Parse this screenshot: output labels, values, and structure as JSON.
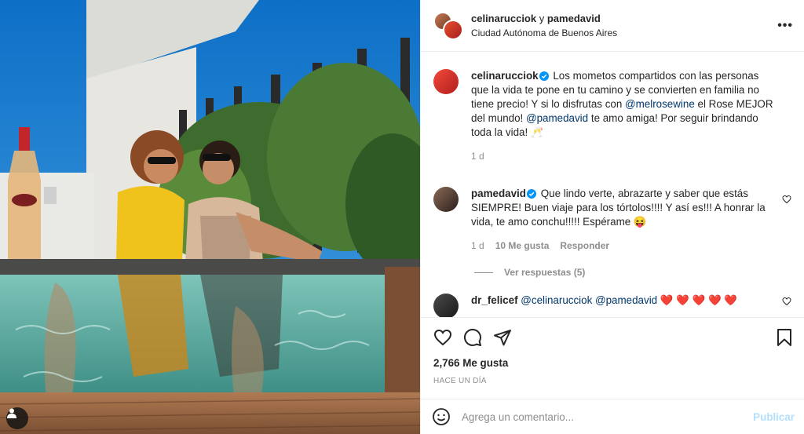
{
  "header": {
    "user1": "celinarucciok",
    "separator": "y",
    "user2": "pamedavid",
    "location": "Ciudad Autónoma de Buenos Aires",
    "more_icon": "more-horizontal-icon"
  },
  "comments": [
    {
      "username": "celinarucciok",
      "verified": true,
      "text_before": "Los mometos compartidos con las personas que la vida te pone en tu camino y se convierten en familia no tiene precio! Y si lo disfrutas con",
      "mention1": "@melrosewine",
      "text_middle": "el Rose MEJOR del mundo!",
      "mention2": "@pamedavid",
      "text_after": "te amo amiga! Por seguir brindando toda la vida! 🥂",
      "time": "1 d"
    },
    {
      "username": "pamedavid",
      "verified": true,
      "text": "Que lindo verte, abrazarte y saber que estás SIEMPRE! Buen viaje para los tórtolos!!!! Y así es!!! A honrar la vida, te amo conchu!!!!! Espérame 😝",
      "time": "1 d",
      "likes": "10 Me gusta",
      "reply": "Responder",
      "view_replies": "Ver respuestas (5)"
    },
    {
      "username": "dr_felicef",
      "mention1": "@celinarucciok",
      "mention2": "@pamedavid",
      "hearts": "❤️ ❤️ ❤️ ❤️ ❤️"
    }
  ],
  "actions": {
    "likes": "2,766 Me gusta",
    "time_ago": "HACE UN DÍA"
  },
  "add_comment": {
    "placeholder": "Agrega un comentario...",
    "post": "Publicar"
  },
  "colors": {
    "mention": "#00376b",
    "verified": "#0095f6",
    "post_disabled": "#b2dffc",
    "muted": "#8e8e8e"
  }
}
